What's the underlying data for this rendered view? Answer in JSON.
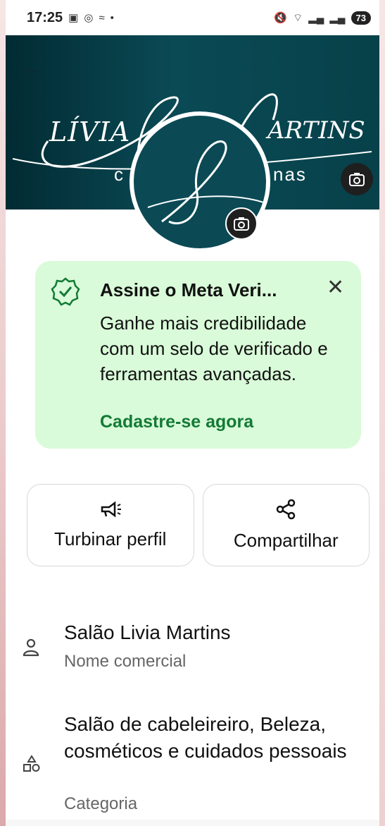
{
  "status": {
    "time": "17:25",
    "left_icons": [
      "gallery-icon",
      "instagram-icon",
      "wavy-icon",
      "dot-icon"
    ],
    "right_icons": [
      "mute-icon",
      "wifi-icon",
      "signal-icon",
      "signal-icon"
    ],
    "battery": "73"
  },
  "cover": {
    "script_left": "LÍVIA",
    "script_right": "ARTINS",
    "sub_left": "c",
    "sub_right": "nas"
  },
  "verify": {
    "title": "Assine o Meta Veri...",
    "body": "Ganhe mais credibilidade com um selo de verificado e ferramentas avançadas.",
    "cta": "Cadastre-se agora"
  },
  "actions": {
    "boost_label": "Turbinar perfil",
    "share_label": "Compartilhar"
  },
  "fields": {
    "name_value": "Salão Livia Martins",
    "name_label": "Nome comercial",
    "category_value": "Salão de cabeleireiro, Beleza, cosméticos e cuidados pessoais",
    "category_label": "Categoria"
  },
  "colors": {
    "accent": "#137a36",
    "banner": "#d9fbd9",
    "cover": "#0a4a55"
  }
}
